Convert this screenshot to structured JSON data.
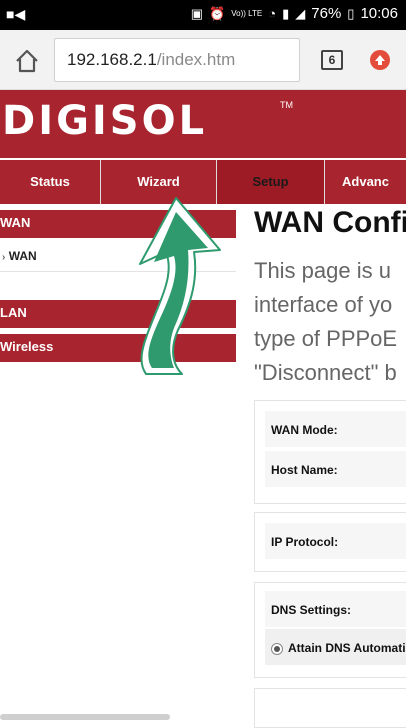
{
  "statusbar": {
    "left_icon": "video-icon",
    "volte": "Vo)) LTE",
    "battery_percent": "76%",
    "time": "10:06"
  },
  "addressbar": {
    "url_host": "192.168.2.1",
    "url_path": "/index.htm",
    "tab_count": "6"
  },
  "brand": {
    "logo": "DIGISOL",
    "trademark": "TM",
    "color": "#a8242e"
  },
  "nav": {
    "items": [
      "Status",
      "Wizard",
      "Setup",
      "Advanc"
    ],
    "active": "Setup"
  },
  "sidebar": {
    "wan_header": "WAN",
    "wan_item": "WAN",
    "lan_header": "LAN",
    "wireless_header": "Wireless"
  },
  "content": {
    "title": "WAN Confi",
    "desc_lines": [
      "This page is u",
      "interface of yo",
      "type of PPPoE",
      "\"Disconnect\" b"
    ]
  },
  "form": {
    "wan_mode_label": "WAN Mode:",
    "host_name_label": "Host Name:",
    "ip_protocol_label": "IP Protocol:",
    "dns_settings_label": "DNS Settings:",
    "dns_option_label": "Attain DNS Automati"
  },
  "annotation": {
    "arrow_color": "#2e9a6e"
  }
}
